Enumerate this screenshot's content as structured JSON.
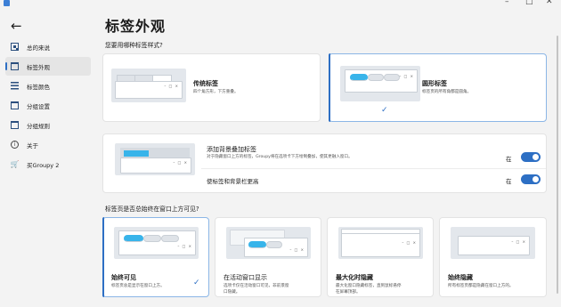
{
  "window": {
    "minimize": "–",
    "maximize": "□",
    "close": "✕"
  },
  "back_label": "←",
  "page_title": "标签外观",
  "nav": [
    {
      "label": "总的来说",
      "icon": "grid-icon"
    },
    {
      "label": "标签外观",
      "icon": "window-tabs-icon",
      "active": true
    },
    {
      "label": "标签颜色",
      "icon": "color-stripes-icon"
    },
    {
      "label": "分组设置",
      "icon": "group-settings-icon"
    },
    {
      "label": "分组规则",
      "icon": "group-rules-icon"
    },
    {
      "label": "关于",
      "icon": "info-icon",
      "glyph": "i"
    },
    {
      "label": "买Groupy 2",
      "icon": "cart-icon",
      "glyph": "🛒"
    }
  ],
  "style_section": {
    "question": "您要用哪种标签样式?",
    "options": [
      {
        "title": "传统标签",
        "desc": "四个角方形，下方重叠。",
        "selected": false
      },
      {
        "title": "圆形标签",
        "desc": "标签页的所有角都是圆角。",
        "selected": true,
        "check": "✓"
      }
    ]
  },
  "stacking": {
    "title": "添加背景叠加标签",
    "desc": "对于隐藏窗口上方的标签，Groupy将在选项卡下方绘制叠加，使其更融入窗口。",
    "toggle1": {
      "state": "在",
      "on": true
    },
    "second_label": "使标签和背景栏更高",
    "toggle2": {
      "state": "在",
      "on": true
    }
  },
  "visibility_section": {
    "question": "标签页是否总始终在窗口上方可见?",
    "options": [
      {
        "title": "始终可见",
        "desc": "标签页总是显示在窗口上方。",
        "selected": true,
        "check": "✓"
      },
      {
        "title": "在活动窗口显示",
        "desc": "选项卡仅在活动窗口可见，非前景窗口隐藏。",
        "selected": false
      },
      {
        "title": "最大化时隐藏",
        "desc": "最大化窗口隐藏标签，直到鼠标悬停在屏幕顶部。",
        "selected": false
      },
      {
        "title": "始终隐藏",
        "desc": "所有标签页都是隐藏在窗口上方的。",
        "selected": false
      }
    ]
  },
  "preview_ctrl": "– □ ×",
  "colors": {
    "accent": "#2d6fc4",
    "tab_highlight": "#38b4ea",
    "background": "#f3f3f3",
    "card": "#ffffff"
  }
}
